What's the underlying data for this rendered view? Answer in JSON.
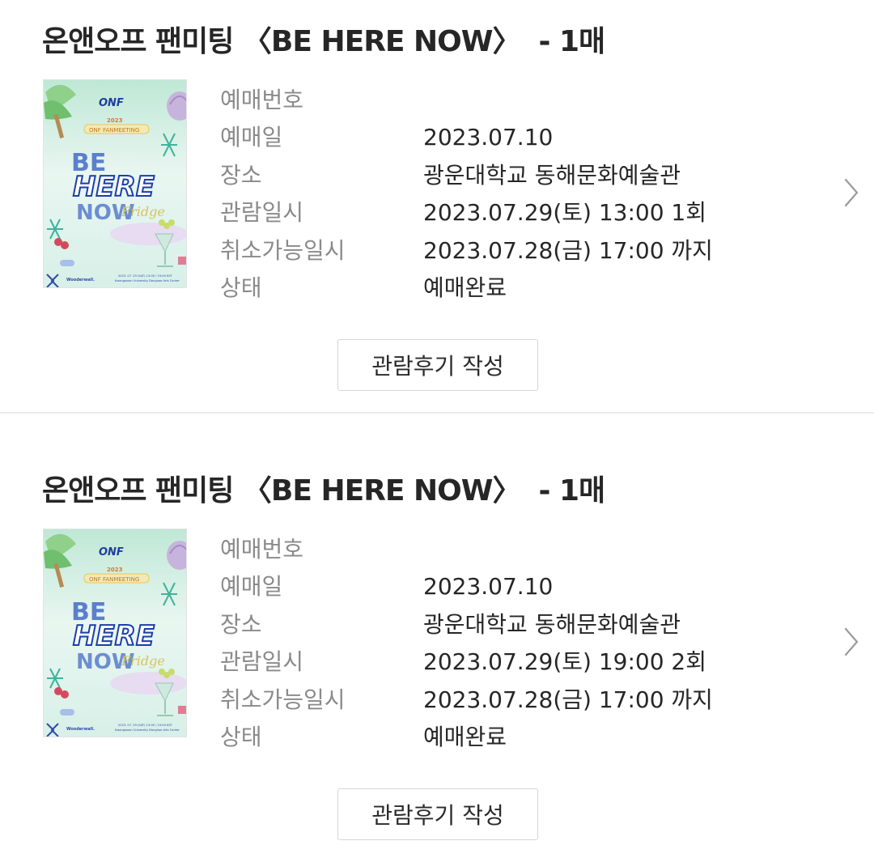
{
  "bookings": [
    {
      "title": "온앤오프 팬미팅 〈BE HERE NOW〉",
      "quantity": "- 1매",
      "poster": {
        "brand": "ONF",
        "headline_top": "BE",
        "headline_mid": "HERE",
        "headline_bottom": "NOW",
        "script": "Fridge",
        "year_badge": "2023",
        "label_badge": "ONF FANMEETING",
        "agency": "Wooderwall.",
        "footer_line1": "2023. 07. 29 (SAT) 13:00 / 19:00 KST",
        "footer_line2": "Kwangwoon University Donghae Arts Center"
      },
      "rows": [
        {
          "label": "예매번호",
          "value": ""
        },
        {
          "label": "예매일",
          "value": "2023.07.10"
        },
        {
          "label": "장소",
          "value": "광운대학교 동해문화예술관"
        },
        {
          "label": "관람일시",
          "value": "2023.07.29(토) 13:00 1회"
        },
        {
          "label": "취소가능일시",
          "value": "2023.07.28(금) 17:00 까지"
        },
        {
          "label": "상태",
          "value": "예매완료"
        }
      ],
      "review_button": "관람후기 작성"
    },
    {
      "title": "온앤오프 팬미팅 〈BE HERE NOW〉",
      "quantity": "- 1매",
      "poster": {
        "brand": "ONF",
        "headline_top": "BE",
        "headline_mid": "HERE",
        "headline_bottom": "NOW",
        "script": "Fridge",
        "year_badge": "2023",
        "label_badge": "ONF FANMEETING",
        "agency": "Wooderwall.",
        "footer_line1": "2023. 07. 29 (SAT) 13:00 / 19:00 KST",
        "footer_line2": "Kwangwoon University Donghae Arts Center"
      },
      "rows": [
        {
          "label": "예매번호",
          "value": ""
        },
        {
          "label": "예매일",
          "value": "2023.07.10"
        },
        {
          "label": "장소",
          "value": "광운대학교 동해문화예술관"
        },
        {
          "label": "관람일시",
          "value": "2023.07.29(토) 19:00 2회"
        },
        {
          "label": "취소가능일시",
          "value": "2023.07.28(금) 17:00 까지"
        },
        {
          "label": "상태",
          "value": "예매완료"
        }
      ],
      "review_button": "관람후기 작성"
    }
  ],
  "icons": {
    "chevron": "chevron-right-icon"
  },
  "colors": {
    "title": "#262626",
    "label": "#8a8a8a",
    "value": "#262626",
    "divider": "#ebebeb",
    "button_border": "#d6d6d6",
    "chevron": "#9a9a9a"
  }
}
